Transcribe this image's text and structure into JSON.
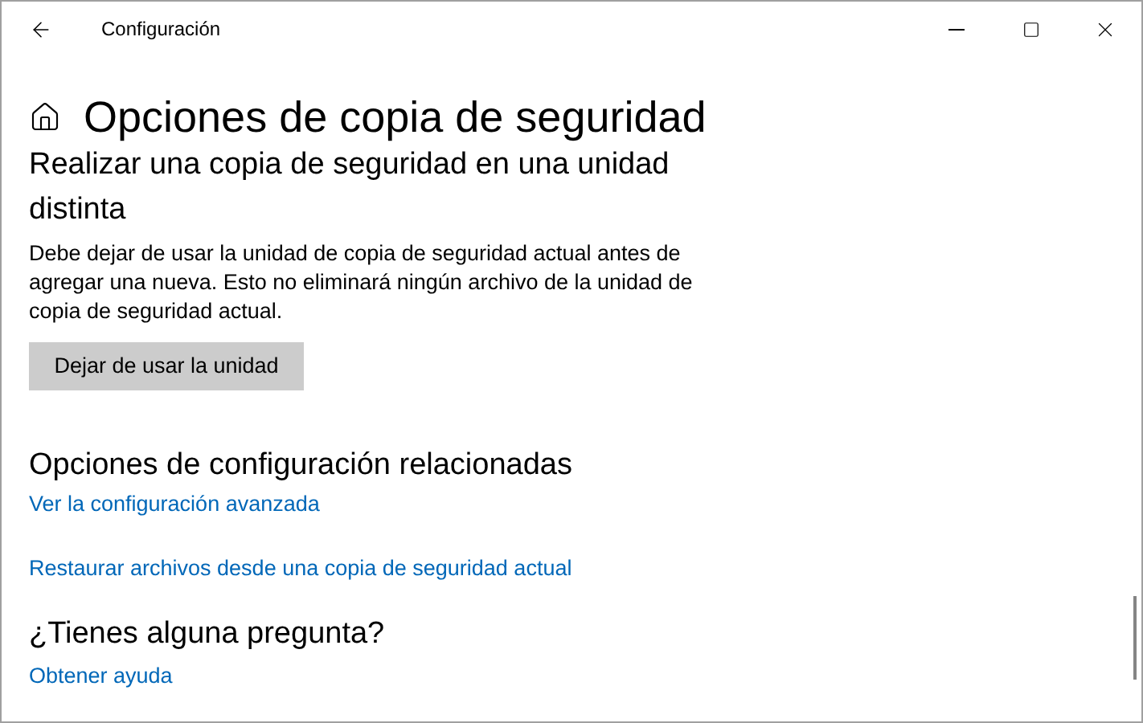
{
  "window": {
    "title": "Configuración"
  },
  "page_title": "Opciones de copia de seguridad",
  "backup_section": {
    "heading": "Realizar una copia de seguridad en una unidad distinta",
    "description": "Debe dejar de usar la unidad de copia de seguridad actual antes de agregar una nueva. Esto no eliminará ningún archivo de la unidad de copia de seguridad actual.",
    "button": "Dejar de usar la unidad"
  },
  "related_section": {
    "heading": "Opciones de configuración relacionadas",
    "links": [
      "Ver la configuración avanzada",
      "Restaurar archivos desde una copia de seguridad actual"
    ]
  },
  "help_section": {
    "heading": "¿Tienes alguna pregunta?",
    "links": [
      "Obtener ayuda"
    ]
  }
}
